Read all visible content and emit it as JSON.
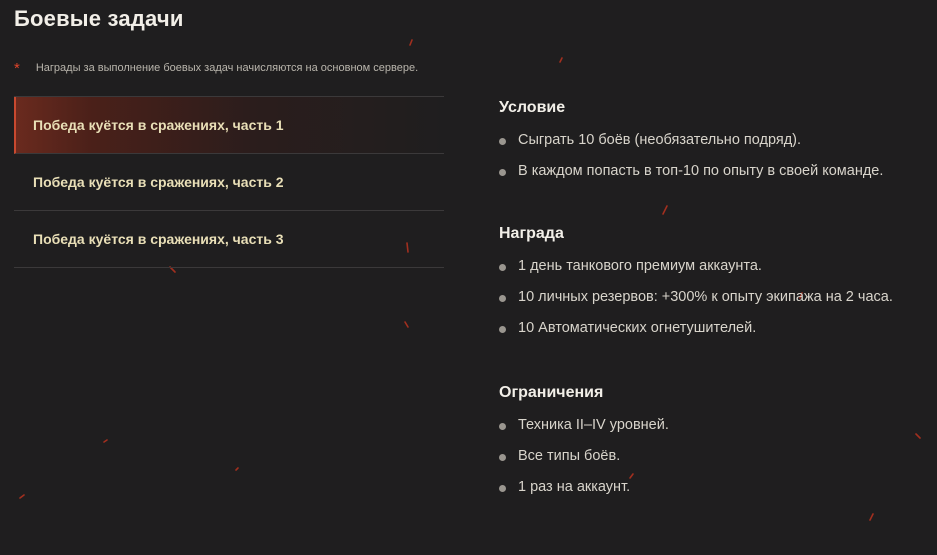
{
  "page": {
    "title": "Боевые задачи",
    "note_marker": "*",
    "note": "Награды за выполнение боевых задач начисляются на основном сервере."
  },
  "quests": [
    {
      "label": "Победа куётся в сражениях, часть 1",
      "active": true
    },
    {
      "label": "Победа куётся в сражениях, часть 2",
      "active": false
    },
    {
      "label": "Победа куётся в сражениях, часть 3",
      "active": false
    }
  ],
  "details": {
    "condition": {
      "title": "Условие",
      "items": [
        "Сыграть 10 боёв (необязательно подряд).",
        "В каждом попасть в топ-10 по опыту в своей команде."
      ]
    },
    "reward": {
      "title": "Награда",
      "items": [
        "1 день танкового премиум аккаунта.",
        "10 личных резервов: +300% к опыту экипажа на 2 часа.",
        "10 Автоматических огнетушителей."
      ]
    },
    "restrictions": {
      "title": "Ограничения",
      "items": [
        "Техника II–IV уровней.",
        "Все типы боёв.",
        "1 раз на аккаунт."
      ]
    }
  },
  "colors": {
    "background": "#1f1e1f",
    "accent": "#c8492f",
    "quest_text": "#e9dfb7"
  }
}
